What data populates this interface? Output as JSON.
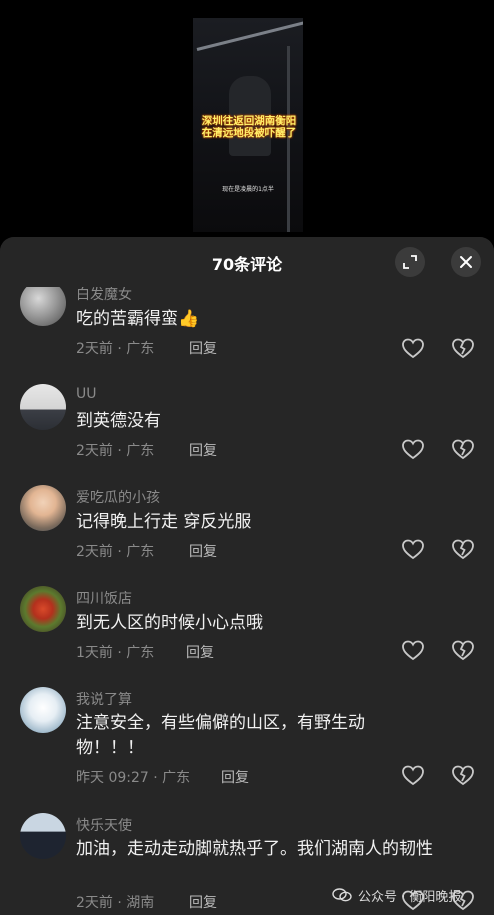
{
  "video": {
    "caption": "深圳往返回湖南衡阳\n在清远地段被吓醒了",
    "subtitle": "现在是凌晨的1点半"
  },
  "sheet": {
    "title": "70条评论"
  },
  "actions": {
    "reply_label": "回复"
  },
  "comments": [
    {
      "name": "白发魔女",
      "text": "吃的苦霸得蛮👍",
      "time": "2天前 · 广东"
    },
    {
      "name": "UU",
      "text": "到英德没有",
      "time": "2天前 · 广东"
    },
    {
      "name": "爱吃瓜的小孩",
      "text": "记得晚上行走  穿反光服",
      "time": "2天前 · 广东"
    },
    {
      "name": "四川饭店",
      "text": "到无人区的时候小心点哦",
      "time": "1天前 · 广东"
    },
    {
      "name": "我说了算",
      "text": "注意安全，有些偏僻的山区，有野生动物！！！",
      "time": "昨天 09:27 · 广东"
    },
    {
      "name": "快乐天使",
      "text": "加油，走动走动脚就热乎了。我们湖南人的韧性",
      "time": "2天前 · 湖南"
    }
  ],
  "watermark": {
    "text": "公众号 · 衡阳晚报"
  },
  "colors": {
    "sheet_bg": "#262626",
    "muted": "#8a8a8a",
    "thumb_icon": "#f0b020"
  }
}
